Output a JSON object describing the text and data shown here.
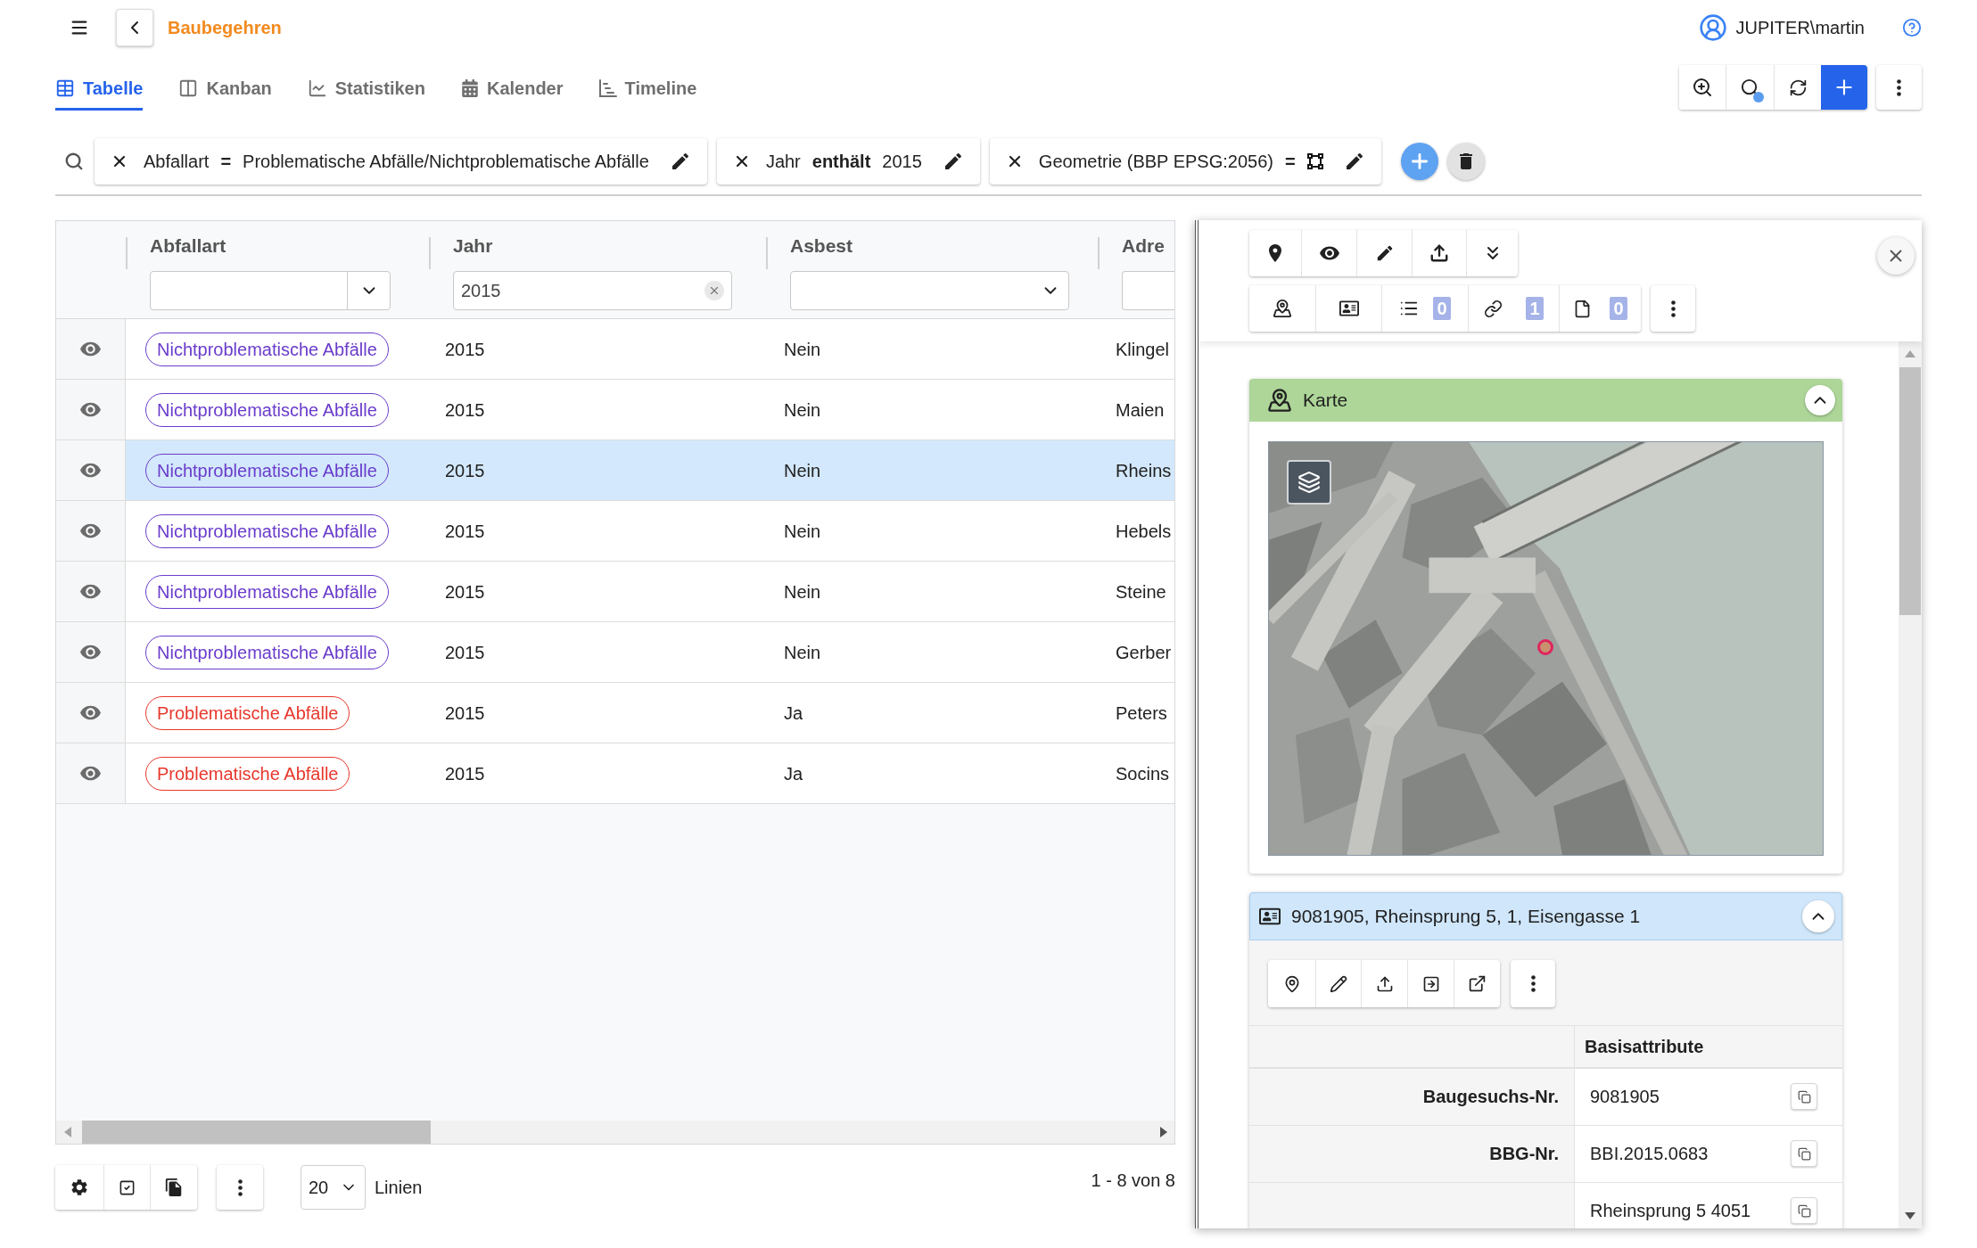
{
  "app_bar": {
    "title": "Baubegehren",
    "user": "JUPITER\\martin"
  },
  "view_tabs": [
    {
      "label": "Tabelle",
      "kind": "table",
      "selected": true
    },
    {
      "label": "Kanban",
      "kind": "kanban",
      "selected": false
    },
    {
      "label": "Statistiken",
      "kind": "chart",
      "selected": false
    },
    {
      "label": "Kalender",
      "kind": "calendar",
      "selected": false
    },
    {
      "label": "Timeline",
      "kind": "timeline",
      "selected": false
    }
  ],
  "toolbar": {
    "search_active": true
  },
  "filters": [
    {
      "field": "Abfallart",
      "operator": "=",
      "kind": "text",
      "value": "Problematische Abfälle/Nichtproblematische Abfälle"
    },
    {
      "field": "Jahr",
      "operator": "enthält",
      "kind": "text",
      "value": "2015"
    },
    {
      "field": "Geometrie (BBP EPSG:2056)",
      "operator": "=",
      "kind": "geometry"
    }
  ],
  "table": {
    "columns": [
      {
        "label": "Abfallart",
        "kind": "select"
      },
      {
        "label": "Jahr",
        "kind": "text",
        "filter_value": "2015"
      },
      {
        "label": "Asbest",
        "kind": "select"
      },
      {
        "label": "Adre",
        "kind": "text"
      }
    ],
    "rows": [
      {
        "abfallart": "Nichtproblematische Abfälle",
        "color": "#6a3ccb",
        "jahr": "2015",
        "asbest": "Nein",
        "adresse": "Klingel",
        "selected": false
      },
      {
        "abfallart": "Nichtproblematische Abfälle",
        "color": "#6a3ccb",
        "jahr": "2015",
        "asbest": "Nein",
        "adresse": "Maien",
        "selected": false
      },
      {
        "abfallart": "Nichtproblematische Abfälle",
        "color": "#6a3ccb",
        "jahr": "2015",
        "asbest": "Nein",
        "adresse": "Rheins",
        "selected": true
      },
      {
        "abfallart": "Nichtproblematische Abfälle",
        "color": "#6a3ccb",
        "jahr": "2015",
        "asbest": "Nein",
        "adresse": "Hebels",
        "selected": false
      },
      {
        "abfallart": "Nichtproblematische Abfälle",
        "color": "#6a3ccb",
        "jahr": "2015",
        "asbest": "Nein",
        "adresse": "Steine",
        "selected": false
      },
      {
        "abfallart": "Nichtproblematische Abfälle",
        "color": "#6a3ccb",
        "jahr": "2015",
        "asbest": "Nein",
        "adresse": "Gerber",
        "selected": false
      },
      {
        "abfallart": "Problematische Abfälle",
        "color": "#e8372c",
        "jahr": "2015",
        "asbest": "Ja",
        "adresse": "Peters",
        "selected": false
      },
      {
        "abfallart": "Problematische Abfälle",
        "color": "#e8372c",
        "jahr": "2015",
        "asbest": "Ja",
        "adresse": "Socins",
        "selected": false
      }
    ],
    "page_size": "20",
    "page_size_label": "Linien",
    "range": "1 - 8 von 8"
  },
  "detail_panel": {
    "counts": {
      "attributes": "0",
      "links": "1",
      "files": "0"
    },
    "map_card": {
      "title": "Karte",
      "expanded": true
    },
    "record_card": {
      "title": "9081905, Rheinsprung 5, 1, Eisengasse 1",
      "expanded": true,
      "section": "Basisattribute",
      "attributes": [
        {
          "label": "Baugesuchs-Nr.",
          "value": "9081905"
        },
        {
          "label": "BBG-Nr.",
          "value": "BBI.2015.0683"
        },
        {
          "value": "Rheinsprung 5 4051"
        }
      ]
    }
  }
}
